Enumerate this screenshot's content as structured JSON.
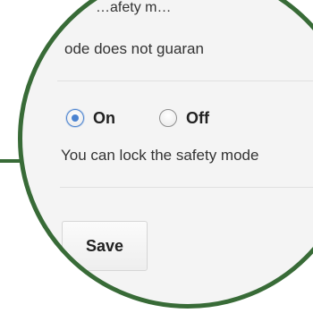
{
  "safety": {
    "top_line_partial": "…afety m…",
    "mode_line_partial": "ode does not guaran",
    "radio_options": [
      {
        "label": "On",
        "selected": true
      },
      {
        "label": "Off",
        "selected": false
      }
    ],
    "lock_text_partial": "You can lock the safety mode",
    "save_label": "Save"
  },
  "colors": {
    "lens_border": "#386b37",
    "radio_selected": "#4b83d0"
  }
}
